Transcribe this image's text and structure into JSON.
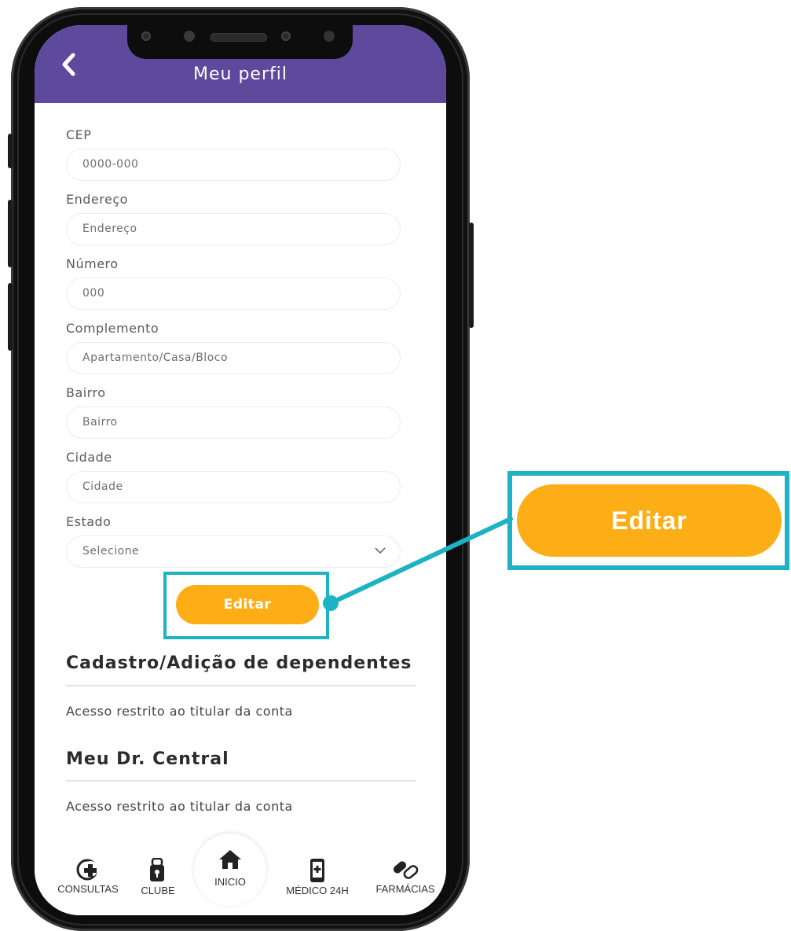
{
  "header": {
    "title": "Meu perfil"
  },
  "form": {
    "fields": [
      {
        "label": "CEP",
        "placeholder": "0000-000"
      },
      {
        "label": "Endereço",
        "placeholder": "Endereço"
      },
      {
        "label": "Número",
        "placeholder": "000"
      },
      {
        "label": "Complemento",
        "placeholder": "Apartamento/Casa/Bloco"
      },
      {
        "label": "Bairro",
        "placeholder": "Bairro"
      },
      {
        "label": "Cidade",
        "placeholder": "Cidade"
      },
      {
        "label": "Estado",
        "placeholder": "Selecione"
      }
    ],
    "edit_label": "Editar"
  },
  "sections": [
    {
      "title": "Cadastro/Adição de dependentes",
      "text": "Acesso restrito ao titular da conta"
    },
    {
      "title": "Meu Dr. Central",
      "text": "Acesso restrito ao titular da conta"
    }
  ],
  "nav": {
    "items": [
      "CONSULTAS",
      "CLUBE",
      "INICIO",
      "MÉDICO 24H",
      "FARMÁCIAS"
    ]
  },
  "callout": {
    "label": "Editar"
  },
  "colors": {
    "header": "#5e4a9c",
    "accent": "#fdae17",
    "highlight": "#1db3c4"
  },
  "icons": [
    "back-chevron-icon",
    "chevron-down-icon",
    "plus-circle-icon",
    "lock-bag-icon",
    "home-icon",
    "phone-medical-icon",
    "pills-icon"
  ]
}
